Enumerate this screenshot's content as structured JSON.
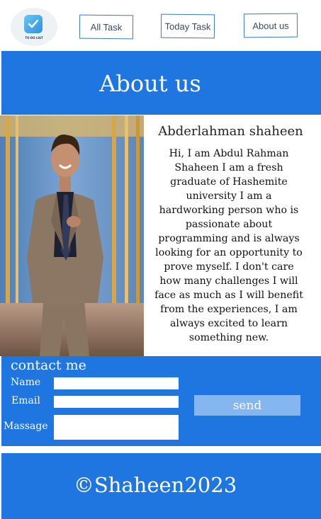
{
  "nav": {
    "logo_text": "TO DO LIST",
    "links": [
      {
        "label": "All Task"
      },
      {
        "label": "Today Task"
      },
      {
        "label": "About us"
      }
    ]
  },
  "hero": {
    "title": "About us"
  },
  "profile": {
    "name": "Abderlahman shaheen",
    "bio": "Hi, I am Abdul Rahman Shaheen I am a fresh graduate of Hashemite university I am a hardworking person who is passionate about programming and is always looking for an opportunity to prove myself. I don't care how many challenges I will face as much as I will benefit from the experiences, I am always excited to learn something new."
  },
  "contact": {
    "title": "contact me",
    "name_label": "Name",
    "email_label": "Email",
    "message_label": "Massage",
    "name_value": "",
    "email_value": "",
    "message_value": "",
    "send_label": "send"
  },
  "footer": {
    "text": "©Shaheen2023"
  },
  "colors": {
    "primary": "#1f76e0",
    "send_button": "#86b6ef",
    "nav_border": "#3a78c6"
  }
}
